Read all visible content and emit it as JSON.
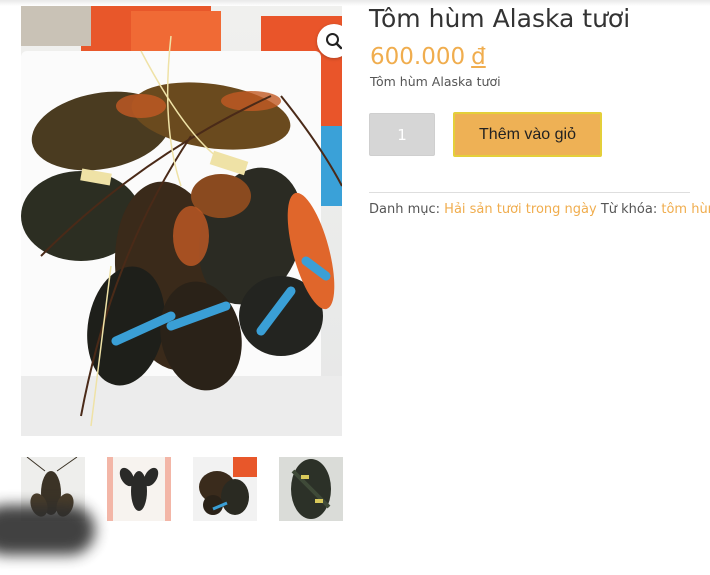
{
  "product": {
    "title": "Tôm hùm Alaska tươi",
    "price_amount": "600.000",
    "price_currency": "đ",
    "short_description": "Tôm hùm Alaska tươi",
    "quantity": "1",
    "add_to_cart_label": "Thêm vào giỏ",
    "zoom_icon": "search-icon"
  },
  "meta": {
    "category_label": "Danh mục:",
    "category_link": "Hải sản tươi trong ngày",
    "tag_label": "Từ khóa:",
    "tag_link": "tôm hùm"
  },
  "gallery": {
    "thumbnail_count": 4
  },
  "colors": {
    "accent": "#f0ad4e",
    "button": "#eeb155",
    "button_border": "#e4cf3a"
  }
}
